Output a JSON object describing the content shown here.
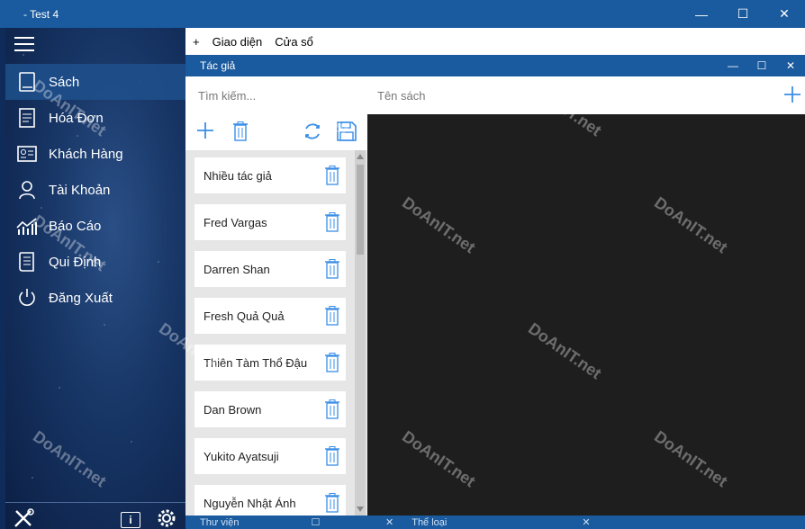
{
  "window": {
    "title": "- Test 4",
    "controls": [
      "—",
      "☐",
      "✕"
    ]
  },
  "sidebar": {
    "items": [
      {
        "label": "Sách",
        "icon": "book-icon",
        "active": true
      },
      {
        "label": "Hóa Đơn",
        "icon": "invoice-icon",
        "active": false
      },
      {
        "label": "Khách Hàng",
        "icon": "contact-card-icon",
        "active": false
      },
      {
        "label": "Tài Khoản",
        "icon": "user-icon",
        "active": false
      },
      {
        "label": "Báo Cáo",
        "icon": "chart-icon",
        "active": false
      },
      {
        "label": "Qui Định",
        "icon": "rules-icon",
        "active": false
      },
      {
        "label": "Đăng Xuất",
        "icon": "power-icon",
        "active": false
      }
    ]
  },
  "menubar": {
    "add": "+",
    "theme": "Giao diện",
    "window": "Cửa sổ"
  },
  "author_window": {
    "title": "Tác giả",
    "search_placeholder": "Tìm kiếm...",
    "authors": [
      "Nhiều tác giả",
      "Fred Vargas",
      "Darren Shan",
      "Fresh Quả Quả",
      "Thiên Tàm Thổ Đậu",
      "Dan Brown",
      "Yukito Ayatsuji",
      "Nguyễn Nhật Ánh"
    ]
  },
  "book_panel": {
    "header_label": "Tên sách",
    "add": "+"
  },
  "bottom_tabs": [
    {
      "label": "Thư viện"
    },
    {
      "label": "Thể loại"
    }
  ],
  "watermark": "DoAnIT.net",
  "colors": {
    "titlebar": "#1a5a9e",
    "accent_blue": "#3a8ee6"
  }
}
